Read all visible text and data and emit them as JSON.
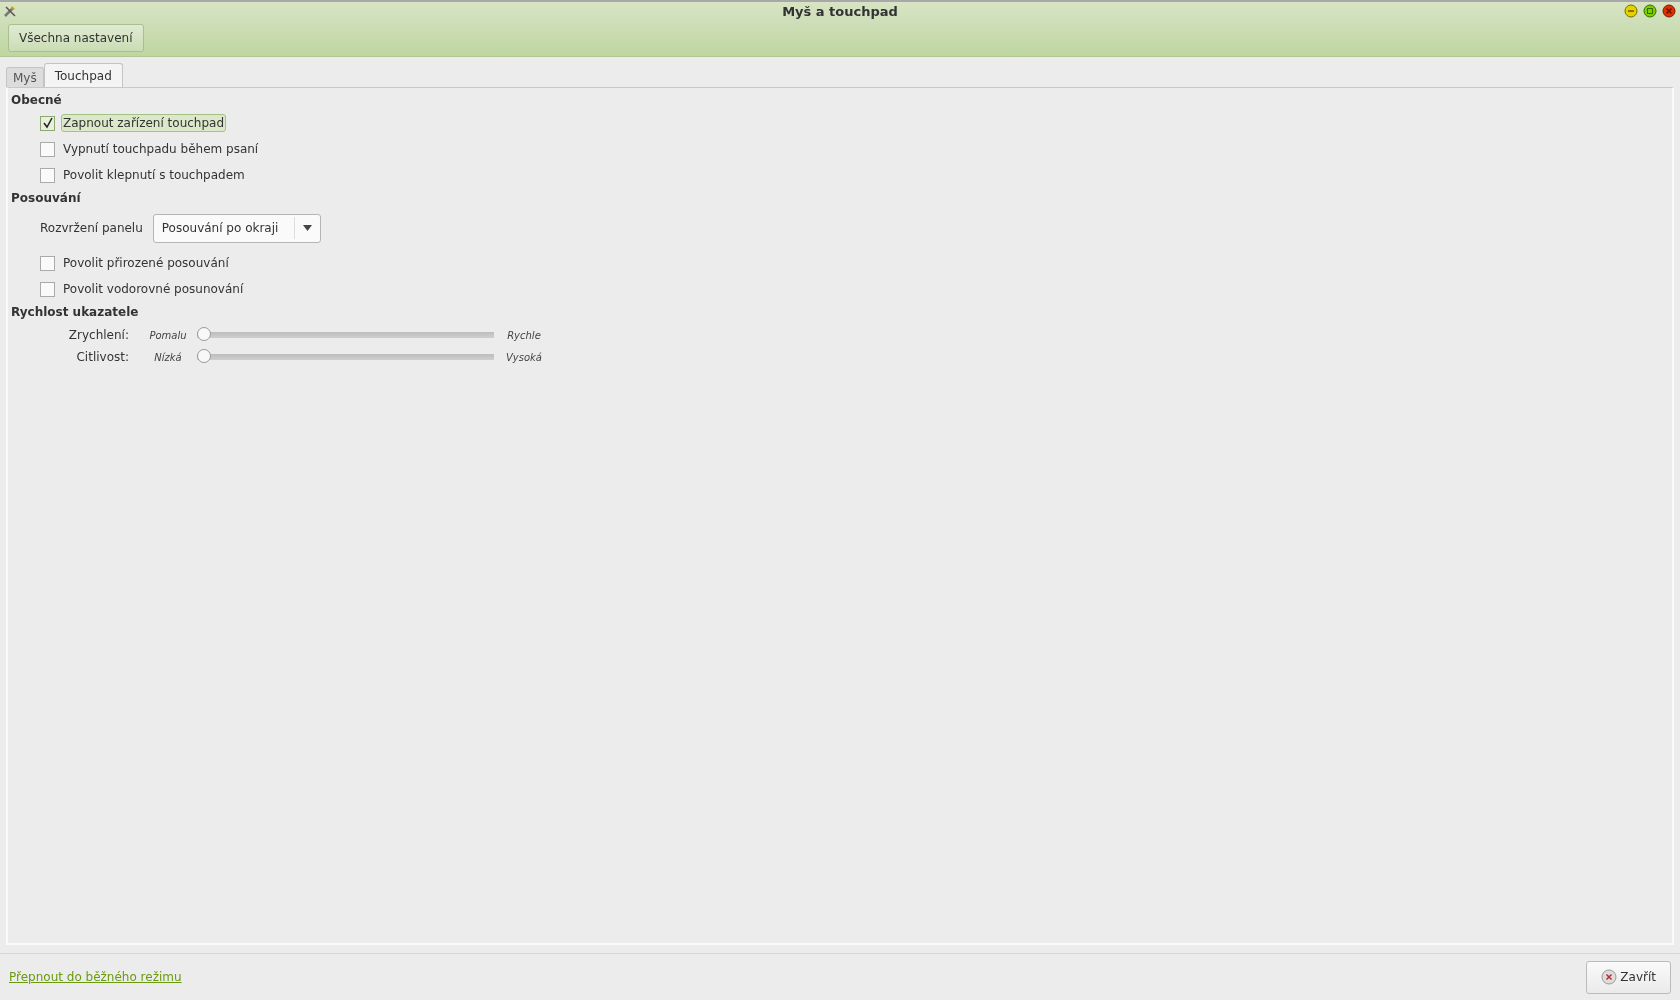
{
  "window": {
    "title": "Myš a touchpad"
  },
  "toolbar": {
    "button": "Všechna nastavení"
  },
  "tabs": [
    {
      "label": "Myš",
      "selected": false
    },
    {
      "label": "Touchpad",
      "selected": true
    }
  ],
  "sections": [
    {
      "title": "Obecné",
      "items": [
        {
          "kind": "checkbox",
          "label": "Zapnout zařízení touchpad",
          "checked": true,
          "focused": true
        },
        {
          "kind": "checkbox",
          "label": "Vypnutí touchpadu během psaní",
          "checked": false,
          "focused": false
        },
        {
          "kind": "checkbox",
          "label": "Povolit klepnutí s touchpadem",
          "checked": false,
          "focused": false
        }
      ]
    },
    {
      "title": "Posouvání",
      "items": [
        {
          "kind": "dropdown",
          "label": "Rozvržení panelu",
          "value": "Posouvání po okraji"
        },
        {
          "kind": "checkbox",
          "label": "Povolit přirozené posouvání",
          "checked": false,
          "focused": false
        },
        {
          "kind": "checkbox",
          "label": "Povolit vodorovné posunování",
          "checked": false,
          "focused": false
        }
      ]
    },
    {
      "title": "Rychlost ukazatele",
      "items": [
        {
          "kind": "slider",
          "label": "Zrychlení:",
          "min_label": "Pomalu",
          "max_label": "Rychle",
          "level": 0
        },
        {
          "kind": "slider",
          "label": "Citlivost:",
          "min_label": "Nízká",
          "max_label": "Vysoká",
          "level": 0
        }
      ]
    }
  ],
  "footer": {
    "link": "Přepnout do běžného režimu",
    "close_button": "Zavřít"
  }
}
